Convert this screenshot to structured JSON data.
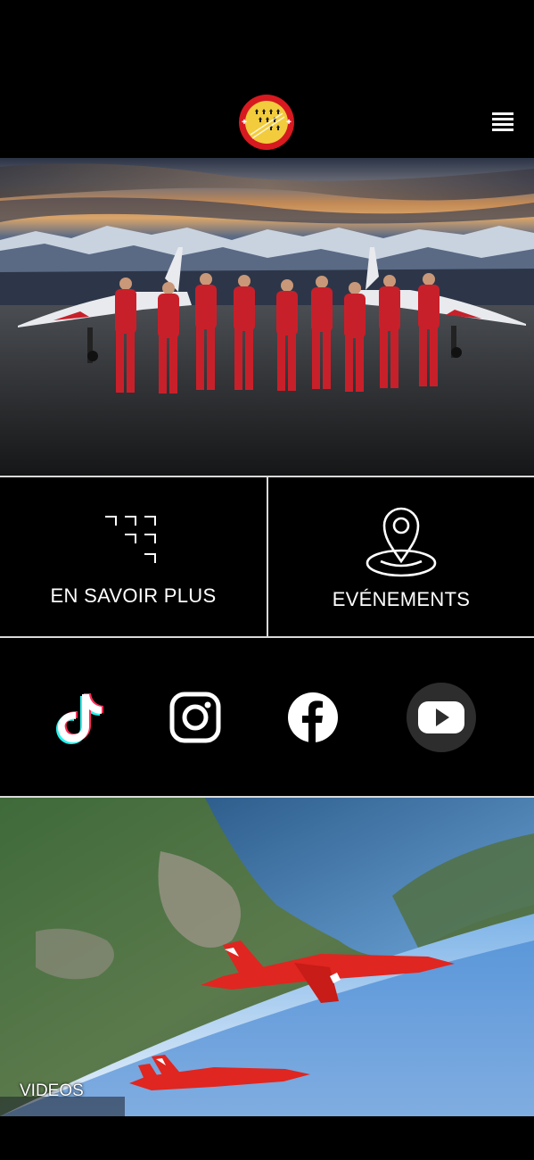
{
  "header": {
    "logo_icon": "patrouille-suisse-logo-icon",
    "menu_icon": "hamburger-menu-icon"
  },
  "hero": {
    "image": "team-photo-pilots-in-red-suits-with-jets"
  },
  "tiles": [
    {
      "label": "EN SAVOIR PLUS",
      "icon": "jets-formation-icon"
    },
    {
      "label": "EVÉNEMENTS",
      "icon": "location-pin-icon"
    }
  ],
  "social": [
    {
      "name": "TikTok",
      "icon": "tiktok-icon"
    },
    {
      "name": "Instagram",
      "icon": "instagram-icon"
    },
    {
      "name": "Facebook",
      "icon": "facebook-icon"
    },
    {
      "name": "YouTube",
      "icon": "youtube-icon"
    }
  ],
  "video": {
    "label": "VIDEOS",
    "image": "jets-flying-over-lake-aerial"
  },
  "colors": {
    "background": "#000000",
    "divider": "#d9d9d9",
    "accent_red": "#d71920",
    "logo_yellow": "#f2cc3c"
  }
}
